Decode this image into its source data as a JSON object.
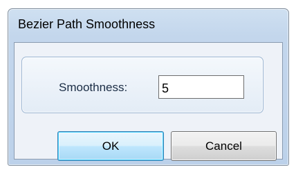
{
  "window": {
    "title": "Bezier Path Smoothness"
  },
  "form": {
    "smoothness_label": "Smoothness:",
    "smoothness_value": "5"
  },
  "buttons": {
    "ok_label": "OK",
    "cancel_label": "Cancel"
  },
  "colors": {
    "frame": "#bcd1ea",
    "client": "#eef2f8",
    "label_text": "#1a2c44",
    "default_button_border": "#3c7fb1"
  }
}
